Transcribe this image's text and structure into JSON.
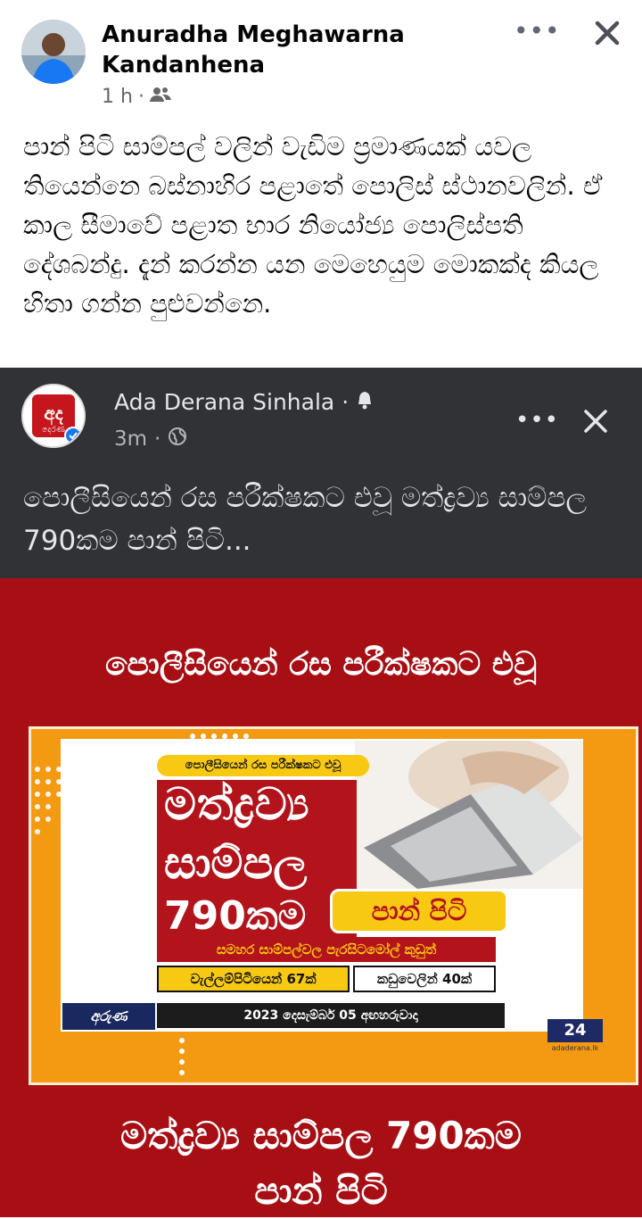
{
  "post": {
    "author": "Anuradha Meghawarna Kandanhena",
    "time": "1 h",
    "separator": "·",
    "audience_icon": "friends-icon",
    "text": "පාන් පිටි සාම්පල් වලින් වැඩිම ප්‍රමාණයක් යවල තියෙන්නෙ බස්නාහිර පළාතේ පොලිස් ස්ථානවලින්. ඒ කාල සීමාවේ පළාත භාර නියෝජ්‍ය පොලිස්පති දේශබන්දු. දැන් කරන්න යන මෙහෙයුම මොකක්ද කියල හිතා ගන්න පුළුවන්නෙ."
  },
  "shared_post": {
    "page_name": "Ada Derana Sinhala",
    "separator": "·",
    "time": "3m",
    "visibility_icon": "globe-icon",
    "bell_icon": "bell-icon",
    "avatar_text": "අද",
    "avatar_subtext": "දෙරණ",
    "text": "පොලීසියෙන් රස පරීක්ෂකට එවූ මත්ද්‍රව්‍ය සාම්පල 790කම පාන් පිටි..."
  },
  "media": {
    "top_caption": "පොලීසියෙන් රස පරීක්ෂකට එවූ",
    "bottom_caption_line1": "මත්ද්‍රව්‍ය සාම්පල 790කම",
    "bottom_caption_line2": "පාන් පිටි",
    "poster": {
      "banner": "පොලීසියෙන් රස පරීක්ෂකට එවූ",
      "big_line1": "මත්ද්‍රව්‍ය",
      "big_line2": "සාම්පල",
      "big_line3": "790කම",
      "pill": "පාන් පිටි",
      "sub": "සමහර සාම්පල්වල පැරසිටමෝල් කුඩුත්",
      "box1": "වැල්ලම්පිටියෙන් 67ක්",
      "box2": "කඩුවෙලින් 40ක්",
      "date": "2023 දෙසැම්බර් 05 අඟහරුවාදා",
      "logo_left": "අරුණ",
      "channel": "24",
      "site": "adaderana.lk"
    }
  },
  "colors": {
    "shared_bg": "#303236",
    "media_red": "#a80f14",
    "frame_orange": "#f39a12",
    "poster_red": "#b3131a",
    "poster_yellow": "#f7c912"
  }
}
